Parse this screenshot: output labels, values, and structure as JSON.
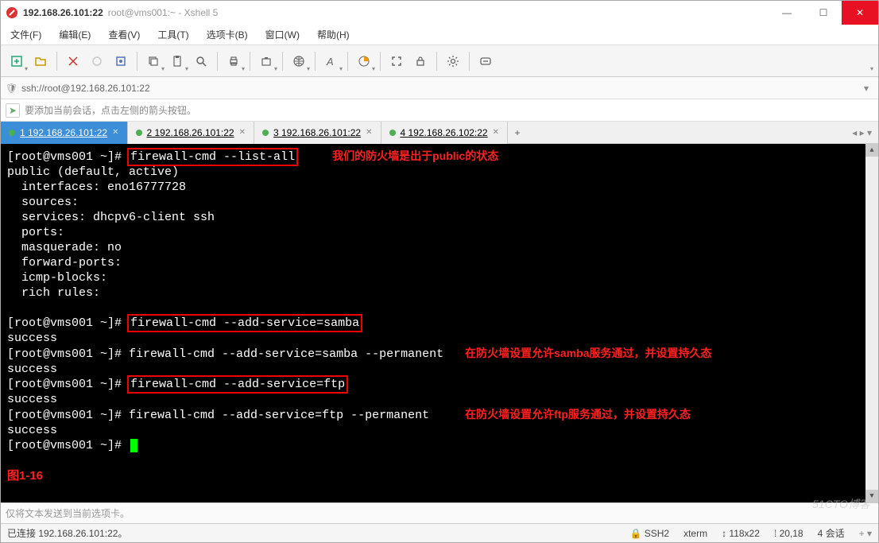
{
  "titlebar": {
    "host": "192.168.26.101:22",
    "subtitle": "root@vms001:~ - Xshell 5"
  },
  "menu": [
    "文件(F)",
    "编辑(E)",
    "查看(V)",
    "工具(T)",
    "选项卡(B)",
    "窗口(W)",
    "帮助(H)"
  ],
  "address": "ssh://root@192.168.26.101:22",
  "hint": "要添加当前会话，点击左侧的箭头按钮。",
  "tabs": [
    {
      "label": "1 192.168.26.101:22",
      "active": true
    },
    {
      "label": "2 192.168.26.101:22",
      "active": false
    },
    {
      "label": "3 192.168.26.101:22",
      "active": false
    },
    {
      "label": "4 192.168.26.102:22",
      "active": false
    }
  ],
  "terminal": {
    "prompt": "[root@vms001 ~]# ",
    "cmd1": "firewall-cmd --list-all",
    "note1": "我们的防火墙是出于public的状态",
    "out1": "public (default, active)\n  interfaces: eno16777728\n  sources:\n  services: dhcpv6-client ssh\n  ports:\n  masquerade: no\n  forward-ports:\n  icmp-blocks:\n  rich rules:",
    "cmd2": "firewall-cmd --add-service=samba",
    "success": "success",
    "cmd3": "firewall-cmd --add-service=samba --permanent",
    "note2": "在防火墙设置允许samba服务通过，并设置持久态",
    "cmd4": "firewall-cmd --add-service=ftp",
    "cmd5": "firewall-cmd --add-service=ftp --permanent",
    "note3": "在防火墙设置允许ftp服务通过，并设置持久态",
    "figure": "图1-16"
  },
  "sendbar": "仅将文本发送到当前选项卡。",
  "status": {
    "left": "已连接 192.168.26.101:22。",
    "proto": "SSH2",
    "term": "xterm",
    "size": "118x22",
    "pos": "20,18",
    "sessions": "4 会话"
  },
  "watermark": "51CTO博客",
  "icons": {
    "lock": "🔒",
    "gear": "⚙",
    "arrow": "➡",
    "plus": "+"
  }
}
